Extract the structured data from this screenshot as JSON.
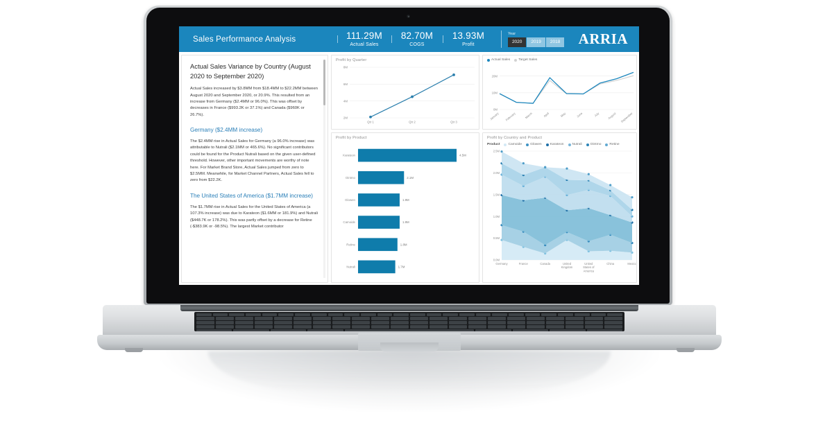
{
  "header": {
    "title": "Sales Performance Analysis",
    "kpis": [
      {
        "value": "111.29M",
        "label": "Actual Sales"
      },
      {
        "value": "82.70M",
        "label": "COGS"
      },
      {
        "value": "13.93M",
        "label": "Profit"
      }
    ],
    "year_filter": {
      "label": "Year",
      "options": [
        "2020",
        "2019",
        "2018"
      ],
      "selected": "2020"
    },
    "logo": "ARRIA",
    "brand_color": "#1b86bd",
    "accent_color": "#2a7fb8"
  },
  "narrative": {
    "heading": "Actual Sales Variance by Country (August 2020 to September 2020)",
    "paragraphs": [
      "Actual Sales increased by $3.8MM from $18.4MM to $22.2MM between August 2020 and September 2020, or 20.9%. This resulted from an increase from Germany ($2.4MM or 96.0%). This was offset by decreases in France ($993.2K or 37.1%) and Canada ($960K or 26.7%)."
    ],
    "sections": [
      {
        "heading": "Germany ($2.4MM increase)",
        "body": "The $2.4MM rise in Actual Sales for Germany (a 96.0% increase) was attributable to Nutrali ($2.1MM or 465.6%). No significant contributors could be found for the Product Nutrali based on the given user-defined threshold. However, other important movements are worthy of note here. For Market Brand Store, Actual Sales jumped from zero to $2.5MM. Meanwhile, for Market Channel Partners, Actual Sales fell to zero from $22.2K."
      },
      {
        "heading": "The United States of America ($1.7MM increase)",
        "body": "The $1.7MM rise in Actual Sales for the United States of America (a 107.3% increase) was due to Karateon ($1.6MM or 181.9%) and Nutrali ($448.7K or 178.2%). This was partly offset by a decrease for Retine (-$383.9K or -98.5%). The largest Market contributor"
      }
    ]
  },
  "chart_data": [
    {
      "id": "profit-by-quarter",
      "type": "line",
      "title": "Profit by Quarter",
      "xlabel": "",
      "ylabel": "",
      "categories": [
        "Qtr 1",
        "Qtr 2",
        "Qtr 3"
      ],
      "values": [
        2.1,
        4.5,
        7.1
      ],
      "ytick_labels": [
        "2M",
        "4M",
        "6M",
        "8M"
      ],
      "ytick_values": [
        2,
        4,
        6,
        8
      ],
      "ylim": [
        2,
        8
      ],
      "grid": true,
      "legend": "none",
      "color": "#2b7fad"
    },
    {
      "id": "profit-by-product",
      "type": "bar",
      "orientation": "horizontal",
      "title": "Profit by Product",
      "categories": [
        "Karateon",
        "Ointmo",
        "Glowen",
        "Camoide",
        "Retine",
        "Nutrali"
      ],
      "values": [
        4.5,
        2.1,
        1.9,
        1.9,
        1.8,
        1.7
      ],
      "data_labels": [
        "4.5M",
        "2.1M",
        "1.9M",
        "1.9M",
        "1.8M",
        "1.7M"
      ],
      "xlim": [
        0,
        4.5
      ],
      "grid": false,
      "legend": "none",
      "color": "#0f7cab"
    },
    {
      "id": "actual-vs-target-sales-by-month",
      "type": "line",
      "title": "",
      "categories": [
        "January",
        "February",
        "March",
        "April",
        "May",
        "June",
        "July",
        "August",
        "September"
      ],
      "series": [
        {
          "name": "Actual Sales",
          "color": "#1b86bd",
          "values": [
            9.5,
            4.3,
            3.7,
            19.0,
            9.5,
            9.3,
            15.8,
            18.4,
            22.2
          ]
        },
        {
          "name": "Target Sales",
          "color": "#d2d2d2",
          "values": [
            9.3,
            4.3,
            3.7,
            17.3,
            9.4,
            9.3,
            15.2,
            17.4,
            20.2
          ]
        }
      ],
      "ytick_labels": [
        "0M",
        "10M",
        "20M"
      ],
      "ytick_values": [
        0,
        10,
        20
      ],
      "ylim": [
        0,
        24
      ],
      "grid": true,
      "legend": "top-left"
    },
    {
      "id": "profit-by-country-and-product",
      "type": "area",
      "stacked": true,
      "title": "Profit by Country and Product",
      "legend_title": "Product",
      "categories": [
        "Germany",
        "France",
        "Canada",
        "United Kingdom",
        "United States of America",
        "China",
        "Mexico"
      ],
      "series": [
        {
          "name": "Camoide",
          "color": "#d3e9f5",
          "values": [
            0.46,
            0.3,
            0.15,
            0.46,
            0.2,
            0.21,
            0.17
          ]
        },
        {
          "name": "Glowen",
          "color": "#9fcde3",
          "values": [
            0.34,
            0.35,
            0.19,
            0.18,
            0.23,
            0.37,
            0.22
          ]
        },
        {
          "name": "Karateon",
          "color": "#7fbdd8",
          "values": [
            0.69,
            0.72,
            1.09,
            0.5,
            0.76,
            0.45,
            0.47
          ]
        },
        {
          "name": "Nutrali",
          "color": "#bddcee",
          "values": [
            0.47,
            0.33,
            0.48,
            0.35,
            0.42,
            0.44,
            0.14
          ]
        },
        {
          "name": "Ointmo",
          "color": "#a8d3e8",
          "values": [
            0.26,
            0.25,
            0.22,
            0.35,
            0.22,
            0.13,
            0.15
          ]
        },
        {
          "name": "Retine",
          "color": "#cbe4f2",
          "values": [
            0.27,
            0.27,
            0.0,
            0.26,
            0.14,
            0.12,
            0.29
          ]
        }
      ],
      "ytick_labels": [
        "0.0M",
        "0.5M",
        "1.0M",
        "1.5M",
        "2.0M",
        "2.5M"
      ],
      "ytick_values": [
        0,
        0.5,
        1.0,
        1.5,
        2.0,
        2.5
      ],
      "ylim": [
        0,
        2.5
      ],
      "grid": true,
      "legend": "top"
    }
  ]
}
